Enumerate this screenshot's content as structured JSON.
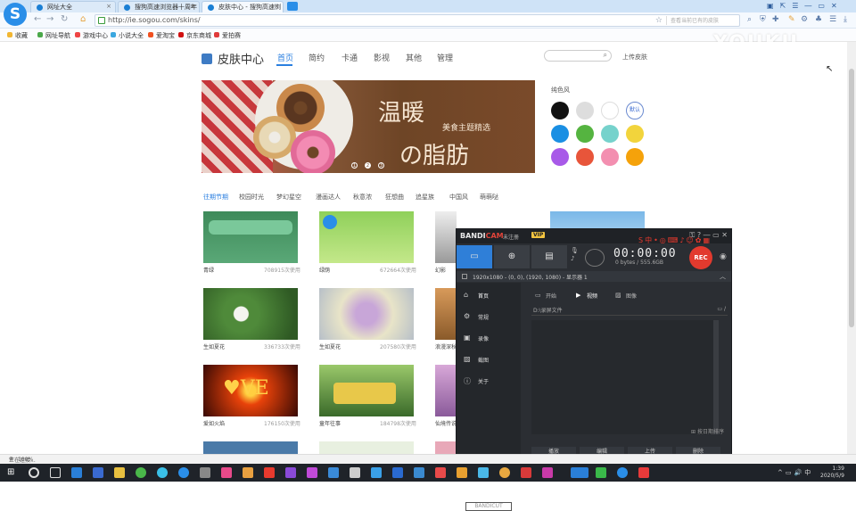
{
  "browser": {
    "tabs": [
      {
        "label": "网址大全"
      },
      {
        "label": "搜狗高速浏览器十周年"
      },
      {
        "label": "皮肤中心 - 搜狗高速浏"
      }
    ],
    "url": "http://ie.sogou.com/skins/",
    "search_hint": "查看当前已有的皮肤",
    "bookmarks": [
      {
        "label": "收藏"
      },
      {
        "label": "网址导航"
      },
      {
        "label": "游戏中心"
      },
      {
        "label": "小说大全"
      },
      {
        "label": "爱淘宝"
      },
      {
        "label": "京东商城"
      },
      {
        "label": "爱拍赛"
      }
    ],
    "watermark": "YOUKU",
    "status": "正在连接...",
    "zoom": "100%"
  },
  "skins": {
    "brand": "皮肤中心",
    "nav": [
      {
        "label": "首页"
      },
      {
        "label": "简约"
      },
      {
        "label": "卡通"
      },
      {
        "label": "影视"
      },
      {
        "label": "其他"
      },
      {
        "label": "管理"
      }
    ],
    "upload": "上传皮肤",
    "banner": {
      "title_line1": "温暖",
      "title_line2": "の脂肪",
      "subtitle": "美食主题精选",
      "dots": [
        "1",
        "2",
        "3"
      ]
    },
    "color_title": "纯色风",
    "default_label": "默认",
    "colors": [
      "#111111",
      "#dddddd",
      "#ffffff",
      "#e9eef7",
      "#1a8fe3",
      "#55b440",
      "#76d2cc",
      "#f2d43c",
      "#a85ae8",
      "#e8553a",
      "#f38fb0",
      "#f5a20a"
    ],
    "categories": [
      {
        "label": "往期节期"
      },
      {
        "label": "校园时光"
      },
      {
        "label": "梦幻星空"
      },
      {
        "label": "漫画达人"
      },
      {
        "label": "秋意浓"
      },
      {
        "label": "狂想曲"
      },
      {
        "label": "追星族"
      },
      {
        "label": "中国风"
      },
      {
        "label": "萌萌哒"
      }
    ],
    "items": [
      {
        "name": "青绿",
        "count": "708915次使用"
      },
      {
        "name": "绿荫",
        "count": "672664次使用"
      },
      {
        "name": "幻影",
        "count": ""
      },
      {
        "name": "",
        "count": ""
      },
      {
        "name": "生如夏花",
        "count": "336733次使用"
      },
      {
        "name": "生如夏花",
        "count": "207580次使用"
      },
      {
        "name": "浪漫深秋",
        "count": ""
      },
      {
        "name": "爱如火焰",
        "count": "176150次使用"
      },
      {
        "name": "童年往事",
        "count": "184798次使用"
      },
      {
        "name": "仙境传说",
        "count": ""
      }
    ]
  },
  "bandicam": {
    "logo_a": "BANDI",
    "logo_b": "CAM",
    "unregistered": "未注册",
    "vip": "VIP",
    "timer": "00:00:00",
    "bytes": "0 bytes / 555.6GB",
    "rec": "REC",
    "resolution": "1920x1080 - (0, 0), (1920, 1080) - 显示器 1",
    "sidebar": [
      {
        "label": "首页"
      },
      {
        "label": "常规"
      },
      {
        "label": "录像"
      },
      {
        "label": "截图"
      },
      {
        "label": "关于"
      }
    ],
    "tabs": [
      {
        "label": "开始"
      },
      {
        "label": "视频"
      },
      {
        "label": "图像"
      }
    ],
    "path": "D:\\录屏文件",
    "sort": "按日期排序",
    "buttons": [
      {
        "label": "播放"
      },
      {
        "label": "编辑"
      },
      {
        "label": "上传"
      },
      {
        "label": "删除"
      }
    ],
    "bandicut": "BANDICUT"
  },
  "taskbar": {
    "time": "1:39",
    "date": "2020/5/9"
  }
}
